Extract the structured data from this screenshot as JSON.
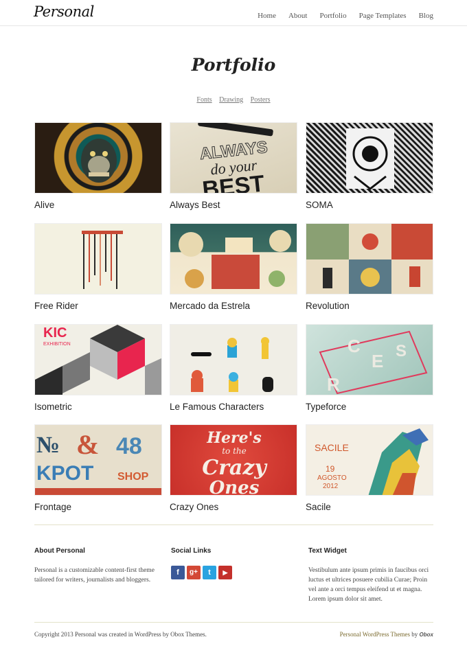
{
  "header": {
    "logo": "Personal",
    "nav": [
      "Home",
      "About",
      "Portfolio",
      "Page Templates",
      "Blog"
    ]
  },
  "page": {
    "title": "Portfolio",
    "filters": [
      "Fonts",
      "Drawing",
      "Posters"
    ]
  },
  "items": [
    {
      "title": "Alive",
      "thumb_text": ""
    },
    {
      "title": "Always Best",
      "thumb_text": "ALWAYS do your BEST"
    },
    {
      "title": "SOMA",
      "thumb_text": ""
    },
    {
      "title": "Free Rider",
      "thumb_text": ""
    },
    {
      "title": "Mercado da Estrela",
      "thumb_text": ""
    },
    {
      "title": "Revolution",
      "thumb_text": ""
    },
    {
      "title": "Isometric",
      "thumb_text": "KIC EXHIBITION"
    },
    {
      "title": "Le Famous Characters",
      "thumb_text": ""
    },
    {
      "title": "Typeforce",
      "thumb_text": ""
    },
    {
      "title": "Frontage",
      "thumb_text": "№ & 48 KPOT SHOP"
    },
    {
      "title": "Crazy Ones",
      "thumb_text": "Here's to the Crazy Ones"
    },
    {
      "title": "Sacile",
      "thumb_text": "SACILE 19 AGOSTO 2012"
    }
  ],
  "footer": {
    "about_title": "About Personal",
    "about_text": "Personal is a customizable content-first theme tailored for writers, journalists and bloggers.",
    "social_title": "Social Links",
    "social_icons": [
      "facebook-icon",
      "google-plus-icon",
      "twitter-icon",
      "youtube-icon"
    ],
    "social_glyphs": [
      "f",
      "g+",
      "t",
      "▶"
    ],
    "widget_title": "Text Widget",
    "widget_text": "Vestibulum ante ipsum primis in faucibus orci luctus et ultrices posuere cubilia Curae; Proin vel ante a orci tempus eleifend ut et magna. Lorem ipsum dolor sit amet.",
    "copyright": "Copyright 2013 Personal was created in WordPress by Obox Themes.",
    "credit_link": "Personal WordPress Themes",
    "credit_by": "by",
    "credit_logo": "Obox"
  },
  "colors": {
    "accent": "#7a6a2e",
    "facebook": "#3b5998",
    "google_plus": "#d34836",
    "twitter": "#2aa3e0",
    "youtube": "#c4302b"
  }
}
